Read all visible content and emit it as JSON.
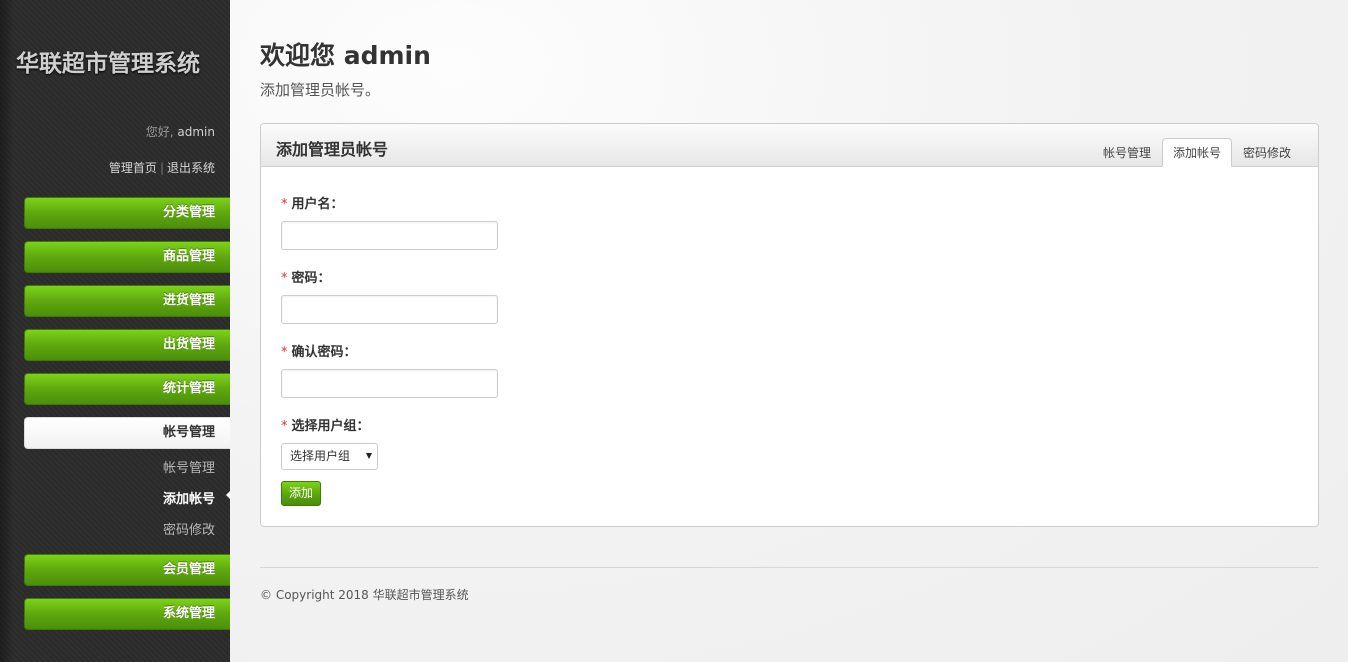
{
  "sidebar": {
    "logo": "华联超市管理系统",
    "greeting_prefix": "您好,",
    "username": "admin",
    "link_home": "管理首页",
    "link_separator": "|",
    "link_logout": "退出系统",
    "menu": [
      {
        "label": "分类管理"
      },
      {
        "label": "商品管理"
      },
      {
        "label": "进货管理"
      },
      {
        "label": "出货管理"
      },
      {
        "label": "统计管理"
      },
      {
        "label": "帐号管理",
        "active": true
      },
      {
        "label": "会员管理"
      },
      {
        "label": "系统管理"
      }
    ],
    "submenu": [
      {
        "label": "帐号管理"
      },
      {
        "label": "添加帐号",
        "current": true
      },
      {
        "label": "密码修改"
      }
    ]
  },
  "header": {
    "title": "欢迎您 admin",
    "subtitle": "添加管理员帐号。"
  },
  "panel": {
    "title": "添加管理员帐号",
    "tabs": [
      {
        "label": "帐号管理"
      },
      {
        "label": "添加帐号",
        "active": true
      },
      {
        "label": "密码修改"
      }
    ]
  },
  "form": {
    "required_mark": "*",
    "username_label": "用户名：",
    "username_value": "",
    "password_label": "密码：",
    "password_value": "",
    "confirm_label": "确认密码：",
    "confirm_value": "",
    "group_label": "选择用户组：",
    "group_selected": "选择用户组",
    "submit_label": "添加"
  },
  "footer": {
    "copyright": "© Copyright 2018 华联超市管理系统"
  },
  "colors": {
    "accent_green": "#5fa80e",
    "sidebar_bg": "#2b2b2b",
    "required_red": "#e03030"
  }
}
